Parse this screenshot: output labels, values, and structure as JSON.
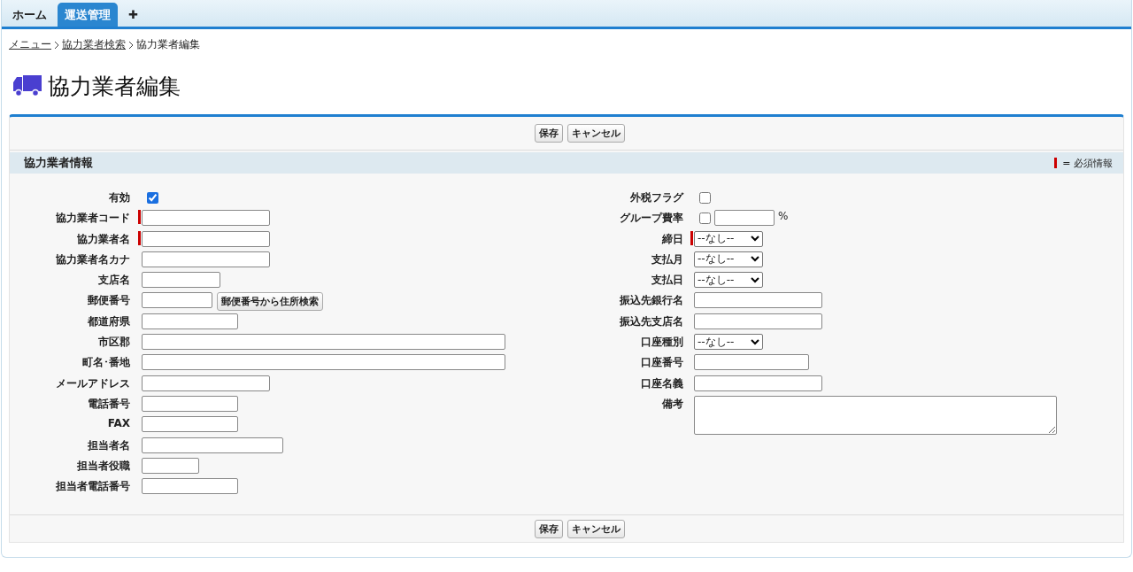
{
  "tabs": [
    {
      "label": "ホーム",
      "selected": false
    },
    {
      "label": "運送管理",
      "selected": true
    },
    {
      "label": "✚",
      "selected": false
    }
  ],
  "breadcrumb": {
    "links": [
      "メニュー",
      "協力業者検索"
    ],
    "current": "協力業者編集"
  },
  "title": "協力業者編集",
  "top_buttons": [
    "保存",
    "キャンセル"
  ],
  "section": {
    "title": "協力業者情報",
    "legend": "= 必須情報"
  },
  "left_fields": [
    {
      "label": "有効",
      "kind": "checkbox",
      "checked": true,
      "required": false
    },
    {
      "label": "協力業者コード",
      "kind": "text",
      "required": true
    },
    {
      "label": "協力業者名",
      "kind": "text",
      "required": true
    },
    {
      "label": "協力業者名カナ",
      "kind": "text",
      "required": false
    },
    {
      "label": "支店名",
      "kind": "text",
      "required": false
    },
    {
      "label": "郵便番号",
      "kind": "postal",
      "button": "郵便番号から住所検索",
      "required": false
    },
    {
      "label": "都道府県",
      "kind": "text",
      "required": false
    },
    {
      "label": "市区郡",
      "kind": "text",
      "required": false
    },
    {
      "label": "町名･番地",
      "kind": "text",
      "required": false
    },
    {
      "label": "メールアドレス",
      "kind": "text",
      "required": false
    },
    {
      "label": "電話番号",
      "kind": "text",
      "required": false
    },
    {
      "label": "FAX",
      "kind": "text",
      "required": false
    },
    {
      "label": "担当者名",
      "kind": "text",
      "required": false
    },
    {
      "label": "担当者役職",
      "kind": "text",
      "required": false
    },
    {
      "label": "担当者電話番号",
      "kind": "text",
      "required": false
    }
  ],
  "right_fields": [
    {
      "label": "外税フラグ",
      "kind": "checkbox",
      "checked": false,
      "required": false
    },
    {
      "label": "グループ費率",
      "kind": "percent",
      "checked": false,
      "unit": "%",
      "required": false
    },
    {
      "label": "締日",
      "kind": "select",
      "value": "--なし--",
      "required": true
    },
    {
      "label": "支払月",
      "kind": "select",
      "value": "--なし--",
      "required": false
    },
    {
      "label": "支払日",
      "kind": "select",
      "value": "--なし--",
      "required": false
    },
    {
      "label": "振込先銀行名",
      "kind": "text",
      "required": false
    },
    {
      "label": "振込先支店名",
      "kind": "text",
      "required": false
    },
    {
      "label": "口座種別",
      "kind": "select",
      "value": "--なし--",
      "required": false
    },
    {
      "label": "口座番号",
      "kind": "text",
      "required": false
    },
    {
      "label": "口座名義",
      "kind": "text",
      "required": false
    },
    {
      "label": "備考",
      "kind": "textarea",
      "required": false
    }
  ],
  "bottom_buttons": [
    "保存",
    "キャンセル"
  ]
}
